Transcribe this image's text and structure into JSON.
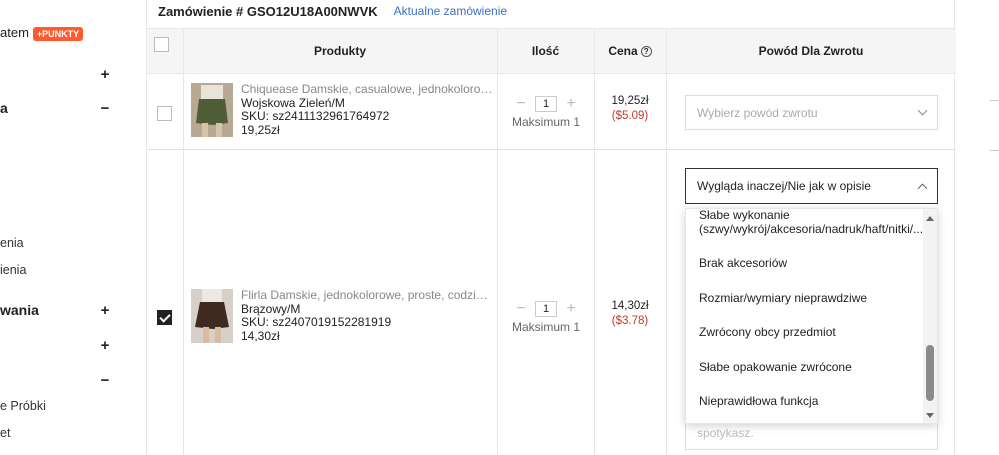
{
  "sidebar": {
    "points_prefix": "atem",
    "points_badge": "+PUNKTY",
    "sections": [
      {
        "label": "",
        "toggle": "+"
      },
      {
        "label": "a",
        "toggle": "−"
      },
      {
        "label": "wania",
        "toggle": "+"
      },
      {
        "label": "",
        "toggle": "+"
      },
      {
        "label": "",
        "toggle": "−"
      }
    ],
    "subitems": [
      "enia",
      "ienia",
      "e Próbki",
      "et"
    ]
  },
  "order": {
    "title": "Zamówienie # GSO12U18A00NWVK",
    "link": "Aktualne zamówienie"
  },
  "table": {
    "headers": {
      "products": "Produkty",
      "quantity": "Ilość",
      "price": "Cena",
      "reason": "Powód Dla Zwrotu"
    },
    "rows": [
      {
        "checked": false,
        "name": "Chiquease Damskie, casualowe, jednokolorowe, …",
        "variant": "Wojskowa Zieleń/M",
        "sku": "SKU: sz2411132961764972",
        "price_line": "19,25zł",
        "qty": "1",
        "qty_max": "Maksimum 1",
        "price_pln": "19,25zł",
        "price_usd": "($5.09)",
        "reason": "Wybierz powód zwrotu",
        "thumb_color": "#4e5d38"
      },
      {
        "checked": true,
        "name": "Flirla Damskie, jednokolorowe, proste, codzienne…",
        "variant": "Brązowy/M",
        "sku": "SKU: sz2407019152281919",
        "price_line": "14,30zł",
        "qty": "1",
        "qty_max": "Maksimum 1",
        "price_pln": "14,30zł",
        "price_usd": "($3.78)",
        "reason": "Wygląda inaczej/Nie jak w opisie",
        "thumb_color": "#3e2a20"
      }
    ]
  },
  "dropdown": {
    "options": [
      "Słabe wykonanie (szwy/wykrój/akcesoria/nadruk/haft/nitki/...)",
      "Brak akcesoriów",
      "Rozmiar/wymiary nieprawdziwe",
      "Zwrócony obcy przedmiot",
      "Słabe opakowanie zwrócone",
      "Nieprawidłowa funkcja"
    ],
    "scroll_position": 0.8
  },
  "textarea_peek": "spotykasz."
}
